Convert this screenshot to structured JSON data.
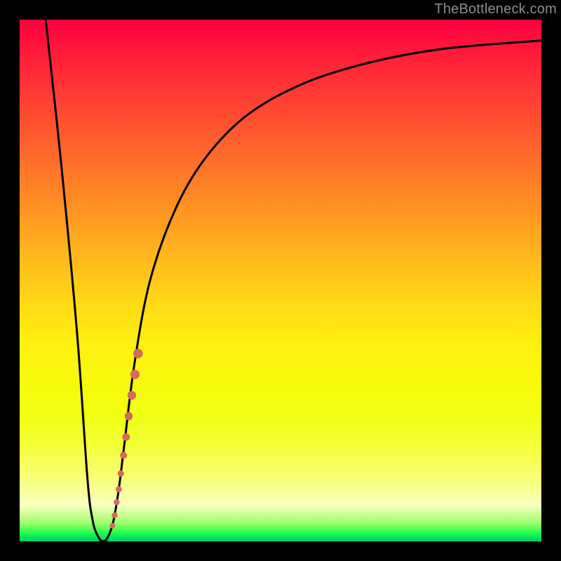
{
  "watermark": "TheBottleneck.com",
  "colors": {
    "curve_stroke": "#000000",
    "dot_fill": "#d46a5e",
    "background": "#000000"
  },
  "chart_data": {
    "type": "line",
    "title": "",
    "xlabel": "",
    "ylabel": "",
    "xlim": [
      0,
      100
    ],
    "ylim": [
      0,
      100
    ],
    "series": [
      {
        "name": "bottleneck-curve",
        "x": [
          5,
          8,
          11,
          13,
          14,
          15,
          16,
          17,
          18,
          19,
          20,
          22,
          25,
          30,
          36,
          44,
          55,
          68,
          82,
          100
        ],
        "y": [
          100,
          72,
          40,
          12,
          4,
          1,
          0,
          1,
          4,
          10,
          18,
          34,
          50,
          64,
          74,
          82,
          88,
          92,
          94.5,
          96
        ]
      }
    ],
    "dots": {
      "name": "highlight-segment",
      "points": [
        {
          "x": 17.8,
          "y": 3.0,
          "r": 4.0
        },
        {
          "x": 18.2,
          "y": 5.0,
          "r": 4.2
        },
        {
          "x": 18.6,
          "y": 7.5,
          "r": 4.2
        },
        {
          "x": 19.0,
          "y": 10.0,
          "r": 4.4
        },
        {
          "x": 19.4,
          "y": 13.0,
          "r": 4.6
        },
        {
          "x": 19.9,
          "y": 16.5,
          "r": 5.0
        },
        {
          "x": 20.4,
          "y": 20.0,
          "r": 5.4
        },
        {
          "x": 20.9,
          "y": 24.0,
          "r": 5.8
        },
        {
          "x": 21.5,
          "y": 28.0,
          "r": 6.2
        },
        {
          "x": 22.1,
          "y": 32.0,
          "r": 6.6
        },
        {
          "x": 22.7,
          "y": 36.0,
          "r": 6.8
        }
      ]
    }
  }
}
